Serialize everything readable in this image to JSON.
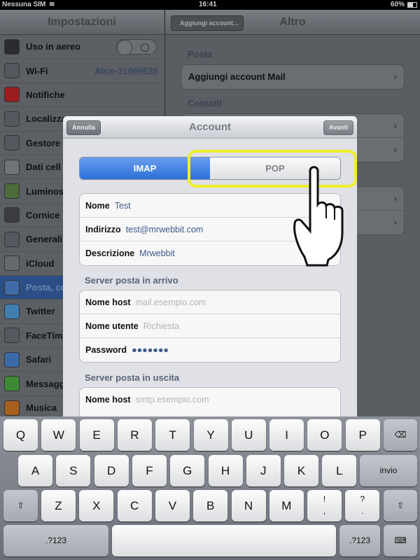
{
  "status": {
    "carrier": "Nessuna SIM",
    "time": "16:41",
    "battery": "60%"
  },
  "left": {
    "title": "Impostazioni",
    "items": [
      {
        "label": "Uso in aereo",
        "icon": "airplane-icon",
        "color": "#2a2b2e"
      },
      {
        "label": "Wi-Fi",
        "icon": "wifi-icon",
        "color": "#55585e",
        "value": "Alice-31669635"
      },
      {
        "label": "Notifiche",
        "icon": "notifications-icon",
        "color": "#9a1e1e"
      },
      {
        "label": "Localizza",
        "icon": "location-icon",
        "color": "#55585e"
      },
      {
        "label": "Gestore",
        "icon": "phone-icon",
        "color": "#55585e"
      },
      {
        "label": "Dati cell",
        "icon": "cellular-icon",
        "color": "#707378"
      },
      {
        "label": "Luminos",
        "icon": "brightness-icon",
        "color": "#4d6a3a"
      },
      {
        "label": "Cornice",
        "icon": "frame-icon",
        "color": "#3a3c40"
      },
      {
        "label": "Generali",
        "icon": "gear-icon",
        "color": "#55585e"
      },
      {
        "label": "iCloud",
        "icon": "cloud-icon",
        "color": "#66696e"
      },
      {
        "label": "Posta, co",
        "icon": "mail-icon",
        "color": "#3e6aa8"
      },
      {
        "label": "Twitter",
        "icon": "twitter-icon",
        "color": "#3f7fb0"
      },
      {
        "label": "FaceTim",
        "icon": "facetime-icon",
        "color": "#55585e"
      },
      {
        "label": "Safari",
        "icon": "safari-icon",
        "color": "#3a6aa5"
      },
      {
        "label": "Messagg",
        "icon": "messages-icon",
        "color": "#3d8a35"
      },
      {
        "label": "Musica",
        "icon": "music-icon",
        "color": "#a8601e"
      }
    ]
  },
  "right": {
    "back": "Aggiungi account...",
    "title": "Altro",
    "posta_label": "Posta",
    "add_mail": "Aggiungi account Mail",
    "contatti_label": "Contatti"
  },
  "modal": {
    "cancel": "Annulla",
    "title": "Account",
    "next": "Avanti",
    "segments": [
      "IMAP",
      "POP"
    ],
    "account": [
      {
        "label": "Nome",
        "value": "Test"
      },
      {
        "label": "Indirizzo",
        "value": "test@mrwebbit.com"
      },
      {
        "label": "Descrizione",
        "value": "Mrwebbit"
      }
    ],
    "incoming_label": "Server posta in arrivo",
    "incoming": [
      {
        "label": "Nome host",
        "placeholder": "mail.esempio.com"
      },
      {
        "label": "Nome utente",
        "placeholder": "Richiesta"
      },
      {
        "label": "Password",
        "value": "●●●●●●●"
      }
    ],
    "outgoing_label": "Server posta in uscita",
    "outgoing": [
      {
        "label": "Nome host",
        "placeholder": "smtp.esempio.com"
      }
    ]
  },
  "keyboard": {
    "row1": [
      "Q",
      "W",
      "E",
      "R",
      "T",
      "Y",
      "U",
      "I",
      "O",
      "P"
    ],
    "row2": [
      "A",
      "S",
      "D",
      "F",
      "G",
      "H",
      "J",
      "K",
      "L"
    ],
    "row3": [
      "Z",
      "X",
      "C",
      "V",
      "B",
      "N",
      "M",
      "!\n,",
      "?\n."
    ],
    "return": "invio",
    "numbers": ".?123",
    "shift": "⇧",
    "backspace": "⌫",
    "hide": "⌨"
  }
}
